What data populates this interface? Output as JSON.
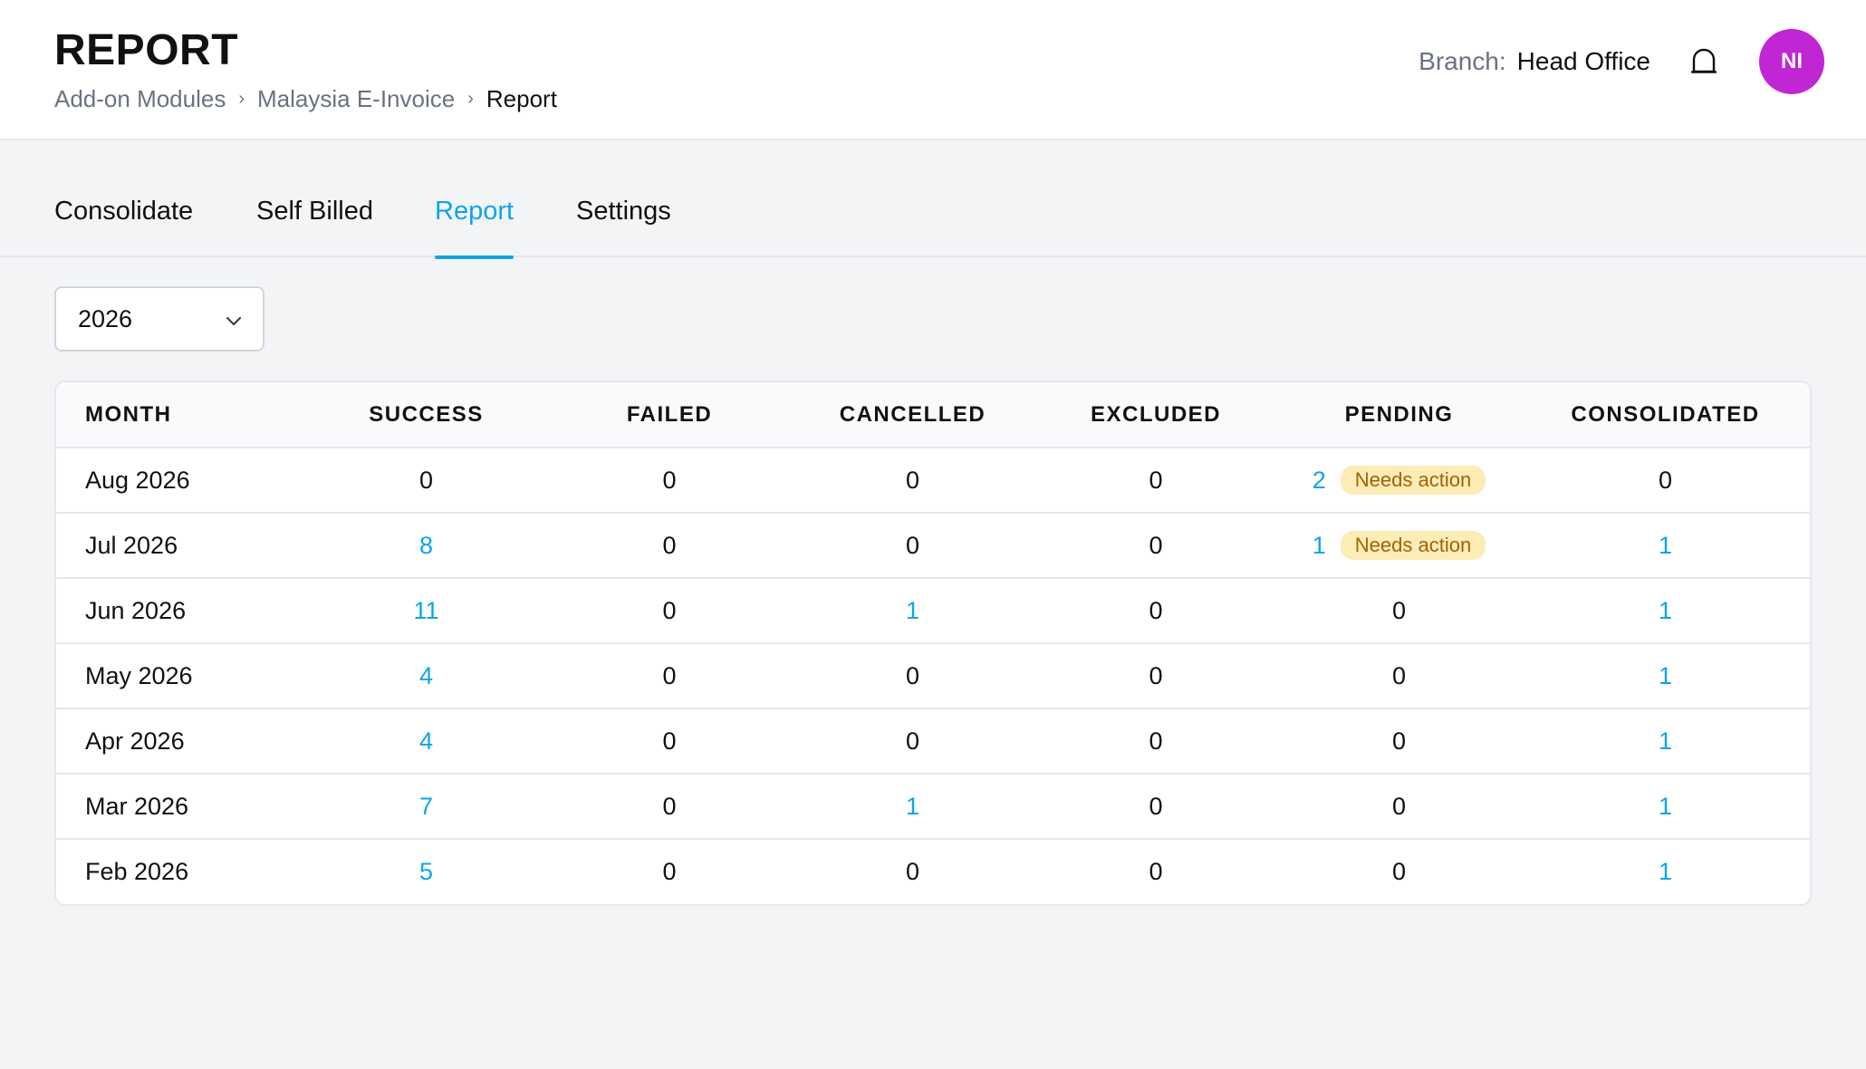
{
  "header": {
    "title": "REPORT",
    "breadcrumb": [
      "Add-on Modules",
      "Malaysia E-Invoice",
      "Report"
    ],
    "branch_label": "Branch:",
    "branch_value": "Head Office",
    "avatar_initials": "NI",
    "avatar_color": "#c026d3"
  },
  "tabs": [
    {
      "label": "Consolidate",
      "active": false
    },
    {
      "label": "Self Billed",
      "active": false
    },
    {
      "label": "Report",
      "active": true
    },
    {
      "label": "Settings",
      "active": false
    }
  ],
  "year_select": {
    "value": "2026"
  },
  "table": {
    "columns": [
      "MONTH",
      "SUCCESS",
      "FAILED",
      "CANCELLED",
      "EXCLUDED",
      "PENDING",
      "CONSOLIDATED"
    ],
    "needs_action_label": "Needs action",
    "rows": [
      {
        "month": "Aug 2026",
        "success": "0",
        "failed": "0",
        "cancelled": "0",
        "excluded": "0",
        "pending": "2",
        "consolidated": "0"
      },
      {
        "month": "Jul 2026",
        "success": "8",
        "failed": "0",
        "cancelled": "0",
        "excluded": "0",
        "pending": "1",
        "consolidated": "1"
      },
      {
        "month": "Jun 2026",
        "success": "11",
        "failed": "0",
        "cancelled": "1",
        "excluded": "0",
        "pending": "0",
        "consolidated": "1"
      },
      {
        "month": "May 2026",
        "success": "4",
        "failed": "0",
        "cancelled": "0",
        "excluded": "0",
        "pending": "0",
        "consolidated": "1"
      },
      {
        "month": "Apr 2026",
        "success": "4",
        "failed": "0",
        "cancelled": "0",
        "excluded": "0",
        "pending": "0",
        "consolidated": "1"
      },
      {
        "month": "Mar 2026",
        "success": "7",
        "failed": "0",
        "cancelled": "1",
        "excluded": "0",
        "pending": "0",
        "consolidated": "1"
      },
      {
        "month": "Feb 2026",
        "success": "5",
        "failed": "0",
        "cancelled": "0",
        "excluded": "0",
        "pending": "0",
        "consolidated": "1"
      }
    ]
  },
  "colors": {
    "accent": "#0ea5e9",
    "badge_bg": "#fdecb6",
    "badge_text": "#a16207"
  },
  "icons": {
    "notification": "bell-icon",
    "dropdown": "chevron-down-icon"
  }
}
